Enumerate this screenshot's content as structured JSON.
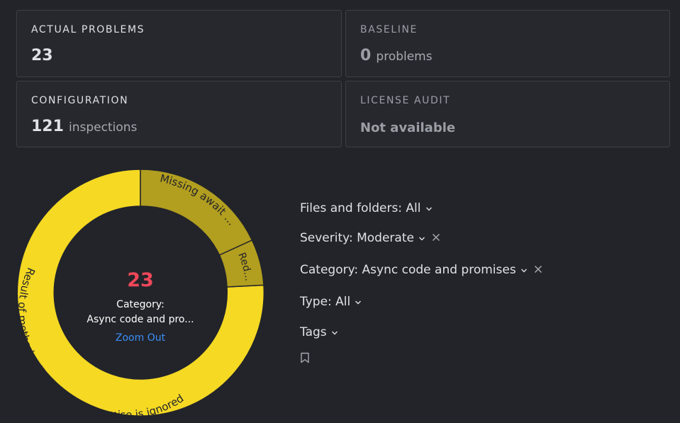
{
  "cards": {
    "actual": {
      "label": "ACTUAL PROBLEMS",
      "value": "23"
    },
    "baseline": {
      "label": "BASELINE",
      "value": "0",
      "unit": "problems"
    },
    "configuration": {
      "label": "CONFIGURATION",
      "value": "121",
      "unit": "inspections"
    },
    "license": {
      "label": "LICENSE AUDIT",
      "value": "Not available"
    }
  },
  "donut": {
    "center_count": "23",
    "center_line1": "Category:",
    "center_line2": "Async code and pro...",
    "zoom_out": "Zoom Out",
    "segments": [
      {
        "label": "Missing await ...",
        "color": "#b29e1f"
      },
      {
        "label": "Red...",
        "color": "#b29e1f"
      },
      {
        "label": "Result of method call returning a promise is ignored",
        "color": "#f5d923"
      }
    ]
  },
  "filters": {
    "files": "Files and folders: All",
    "severity": "Severity: Moderate",
    "category": "Category: Async code and promises",
    "type": "Type: All",
    "tags": "Tags"
  },
  "icons": {
    "chevron": "chevron-down-icon",
    "close": "close-icon",
    "bookmark": "bookmark-icon"
  }
}
